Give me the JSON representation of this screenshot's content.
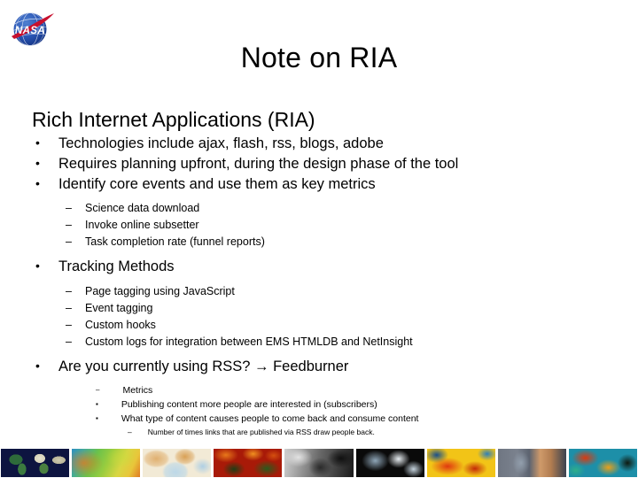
{
  "slide": {
    "title": "Note on RIA",
    "logo_alt": "nasa-meatball-logo"
  },
  "body": {
    "heading": "Rich Internet Applications (RIA)",
    "bullets": [
      {
        "level": 1,
        "marker": "•",
        "text": "Technologies include ajax, flash, rss, blogs, adobe"
      },
      {
        "level": 1,
        "marker": "•",
        "text": "Requires planning upfront, during the design phase of the tool"
      },
      {
        "level": 1,
        "marker": "•",
        "text": "Identify core events and use them as key metrics"
      },
      {
        "level": 2,
        "marker": "–",
        "text": "Science data download"
      },
      {
        "level": 2,
        "marker": "–",
        "text": "Invoke online subsetter"
      },
      {
        "level": 2,
        "marker": "–",
        "text": "Task completion rate (funnel reports)"
      },
      {
        "level": 1,
        "marker": "•",
        "text": "Tracking Methods"
      },
      {
        "level": 2,
        "marker": "–",
        "text": "Page tagging using JavaScript"
      },
      {
        "level": 2,
        "marker": "–",
        "text": "Event tagging"
      },
      {
        "level": 2,
        "marker": "–",
        "text": "Custom hooks"
      },
      {
        "level": 2,
        "marker": "–",
        "text": "Custom logs for integration between EMS HTMLDB and NetInsight"
      },
      {
        "level": 1,
        "marker": "•",
        "text": "Are you currently using RSS? → Feedburner"
      },
      {
        "level": 2,
        "marker": "–",
        "text": "Metrics"
      },
      {
        "level": 3,
        "marker": "▪",
        "text": "Publishing content more people are interested in (subscribers)"
      },
      {
        "level": 3,
        "marker": "▪",
        "text": "What type of content causes people to come back and consume content"
      },
      {
        "level": 4,
        "marker": "–",
        "text": "Number of times links that are published via RSS draw people back."
      }
    ]
  },
  "footer_strip": {
    "name": "earth-science-imagery-strip",
    "tiles": [
      {
        "name": "world-map-dark-tile",
        "colors": [
          "#0d1440",
          "#2e6b3a",
          "#e8e4d0"
        ]
      },
      {
        "name": "green-yellow-gradient-tile",
        "colors": [
          "#2f8fc0",
          "#7fc241",
          "#d8d642"
        ]
      },
      {
        "name": "pale-tan-landmass-tile",
        "colors": [
          "#f2ead6",
          "#e0b070",
          "#bcd8e8"
        ]
      },
      {
        "name": "red-orange-vegetation-tile",
        "colors": [
          "#b81d0c",
          "#e8781a",
          "#1e3d14"
        ]
      },
      {
        "name": "grayscale-satellite-tile",
        "colors": [
          "#c9c9c9",
          "#4a4a4a",
          "#101010"
        ]
      },
      {
        "name": "bw-cloud-imagery-tile",
        "colors": [
          "#0a0a0a",
          "#9fb4c4",
          "#e8eef2"
        ]
      },
      {
        "name": "sst-yellow-red-tile",
        "colors": [
          "#f2c417",
          "#e0380f",
          "#1a4f8a"
        ]
      },
      {
        "name": "slate-tan-bands-tile",
        "colors": [
          "#6f7682",
          "#cf9a6a",
          "#3a4250"
        ]
      },
      {
        "name": "ocean-current-teal-red-tile",
        "colors": [
          "#1d8fa8",
          "#d93a10",
          "#0f1a10"
        ]
      }
    ]
  }
}
